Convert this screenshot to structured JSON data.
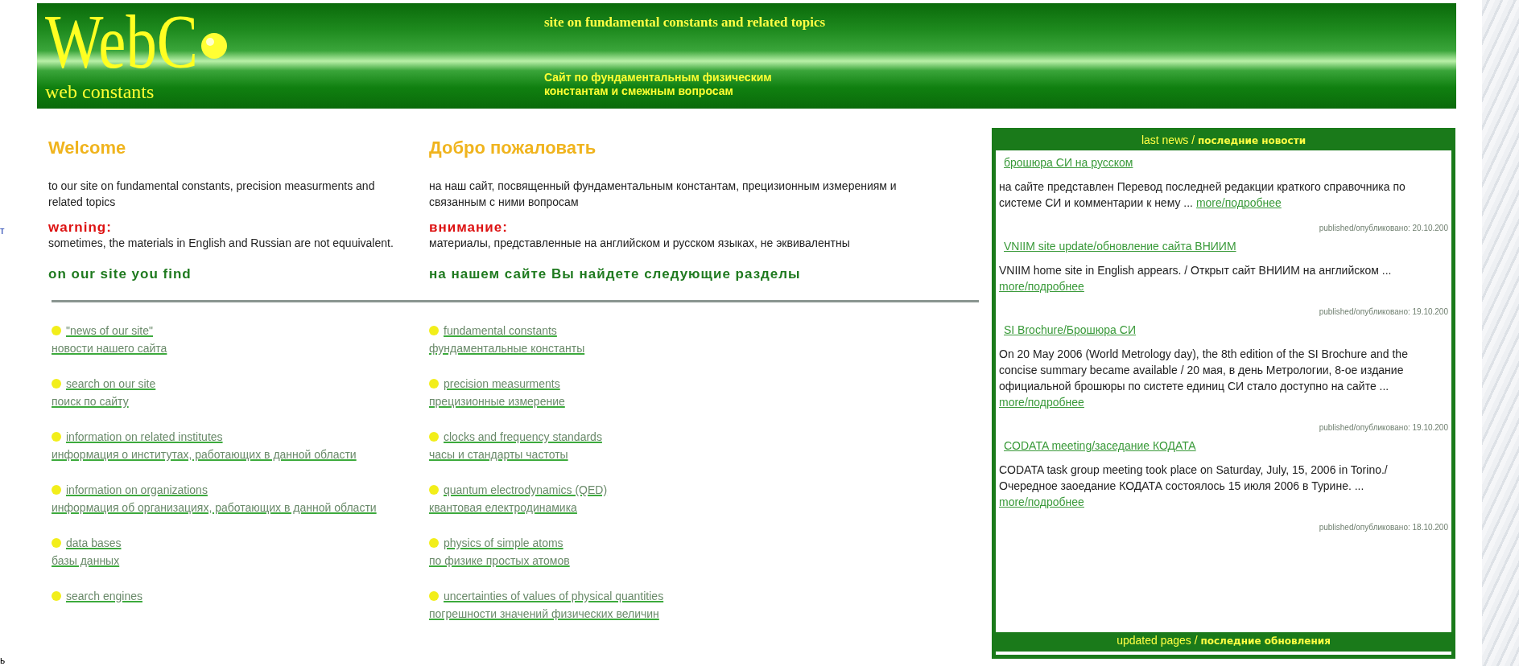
{
  "header": {
    "logo_title": "WebC",
    "logo_subtitle": "web constants",
    "tagline_en": "site on fundamental constants and related topics",
    "tagline_ru": "Сайт по фундаментальным физическим константам и смежным вопросам"
  },
  "edge_fragments": [
    "т",
    "ь"
  ],
  "columns": [
    {
      "heading": "Welcome",
      "intro": "to our site on fundamental constants, precision measurments and related topics",
      "warning_label": "warning:",
      "warning_text": "sometimes, the materials in English and Russian are not equuivalent.",
      "find_heading": "on our site you find",
      "links": [
        {
          "en": "\"news of our site\"",
          "ru": "новости нашего сайта"
        },
        {
          "en": "search on our site",
          "ru": "поиск по сайту"
        },
        {
          "en": "information on related institutes",
          "ru": "информация о институтах, работающих в данной области"
        },
        {
          "en": "information on organizations",
          "ru": "информация об организациях, работающих в данной области"
        },
        {
          "en": "data bases",
          "ru": "базы данных"
        },
        {
          "en": "search engines"
        }
      ]
    },
    {
      "heading": "Добро пожаловать",
      "intro": "на наш сайт, посвященный фундаментальным константам, прецизионным измерениям и связанным с ними вопросам",
      "warning_label": "внимание:",
      "warning_text": "материалы, представленные на английском и русском языках, не эквивалентны",
      "find_heading": "на нашем сайте Вы найдете следующие разделы",
      "links": [
        {
          "en": "fundamental constants",
          "ru": "фундаментальные константы"
        },
        {
          "en": "precision measurments",
          "ru": "прецизионные измерение"
        },
        {
          "en": "clocks and frequency standards",
          "ru": "часы и стандарты частоты"
        },
        {
          "en": "quantum electrodynamics (QED)",
          "ru": "квантовая електродинамика"
        },
        {
          "en": "physics of simple atoms",
          "ru": "по физике простых атомов"
        },
        {
          "en": "uncertainties of values of physical quantities",
          "ru": "погрешности значений физических величин"
        }
      ]
    }
  ],
  "news": {
    "title": "last news / **последние новости**",
    "items": [
      {
        "title": "брошюра СИ на русском",
        "body": "на сайте представлен Перевод последней редакции краткого справочника по системе СИ и комментарии к нему ...",
        "more": "more/подробнее",
        "published": "published/опубликовано: 20.10.200"
      },
      {
        "title": "VNIIM site update/обновление сайта ВНИИМ",
        "body": "VNIIM home site in English appears. / Открыт сайт ВНИИМ на английском ...",
        "more": "more/подробнее",
        "published": "published/опубликовано: 19.10.200"
      },
      {
        "title": "SI Brochure/Брошюра СИ",
        "body": "On 20 May 2006 (World Metrology day), the 8th edition of the SI Brochure and the concise summary became available / 20 мая, в день Метрологии, 8-ое издание официальной брошюры по систете единиц СИ стало доступно на сайте ...",
        "more": "more/подробнее",
        "published": "published/опубликовано: 19.10.200"
      },
      {
        "title": "CODATA meeting/заседание КОДАТА",
        "body": "CODATA task group meeting took place on Saturday, July, 15, 2006 in Torino./ Очередное заоедание КОДАТА состоялось 15 июля 2006 в Турине. ...",
        "more": "more/подробнее",
        "published": "published/опубликовано: 18.10.200"
      }
    ],
    "footer": "updated pages / **последние обновления**"
  }
}
